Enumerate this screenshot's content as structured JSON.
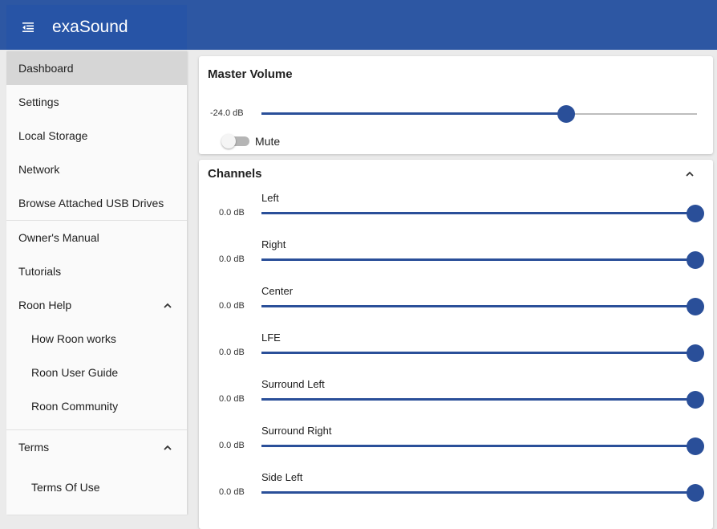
{
  "app": {
    "title": "exaSound",
    "menu_icon": "menu-collapse-icon",
    "accent_color": "#2d57a3"
  },
  "sidebar": {
    "items": [
      {
        "label": "Dashboard",
        "active": true
      },
      {
        "label": "Settings"
      },
      {
        "label": "Local Storage"
      },
      {
        "label": "Network"
      },
      {
        "label": "Browse Attached USB Drives"
      },
      {
        "label": "Owner's Manual"
      },
      {
        "label": "Tutorials"
      },
      {
        "label": "Roon Help",
        "expanded": true
      },
      {
        "label": "How Roon works"
      },
      {
        "label": "Roon User Guide"
      },
      {
        "label": "Roon Community"
      },
      {
        "label": "Terms",
        "expanded": true
      },
      {
        "label": "Terms Of Use"
      }
    ]
  },
  "master_volume": {
    "title": "Master Volume",
    "value_label": "-24.0 dB",
    "level_fraction": 0.7,
    "mute_label": "Mute",
    "muted": false
  },
  "channels": {
    "title": "Channels",
    "expanded": true,
    "list": [
      {
        "name": "Left",
        "value_label": "0.0 dB",
        "level_fraction": 1.0
      },
      {
        "name": "Right",
        "value_label": "0.0 dB",
        "level_fraction": 1.0
      },
      {
        "name": "Center",
        "value_label": "0.0 dB",
        "level_fraction": 1.0
      },
      {
        "name": "LFE",
        "value_label": "0.0 dB",
        "level_fraction": 1.0
      },
      {
        "name": "Surround Left",
        "value_label": "0.0 dB",
        "level_fraction": 1.0
      },
      {
        "name": "Surround Right",
        "value_label": "0.0 dB",
        "level_fraction": 1.0
      },
      {
        "name": "Side Left",
        "value_label": "0.0 dB",
        "level_fraction": 1.0
      }
    ]
  }
}
